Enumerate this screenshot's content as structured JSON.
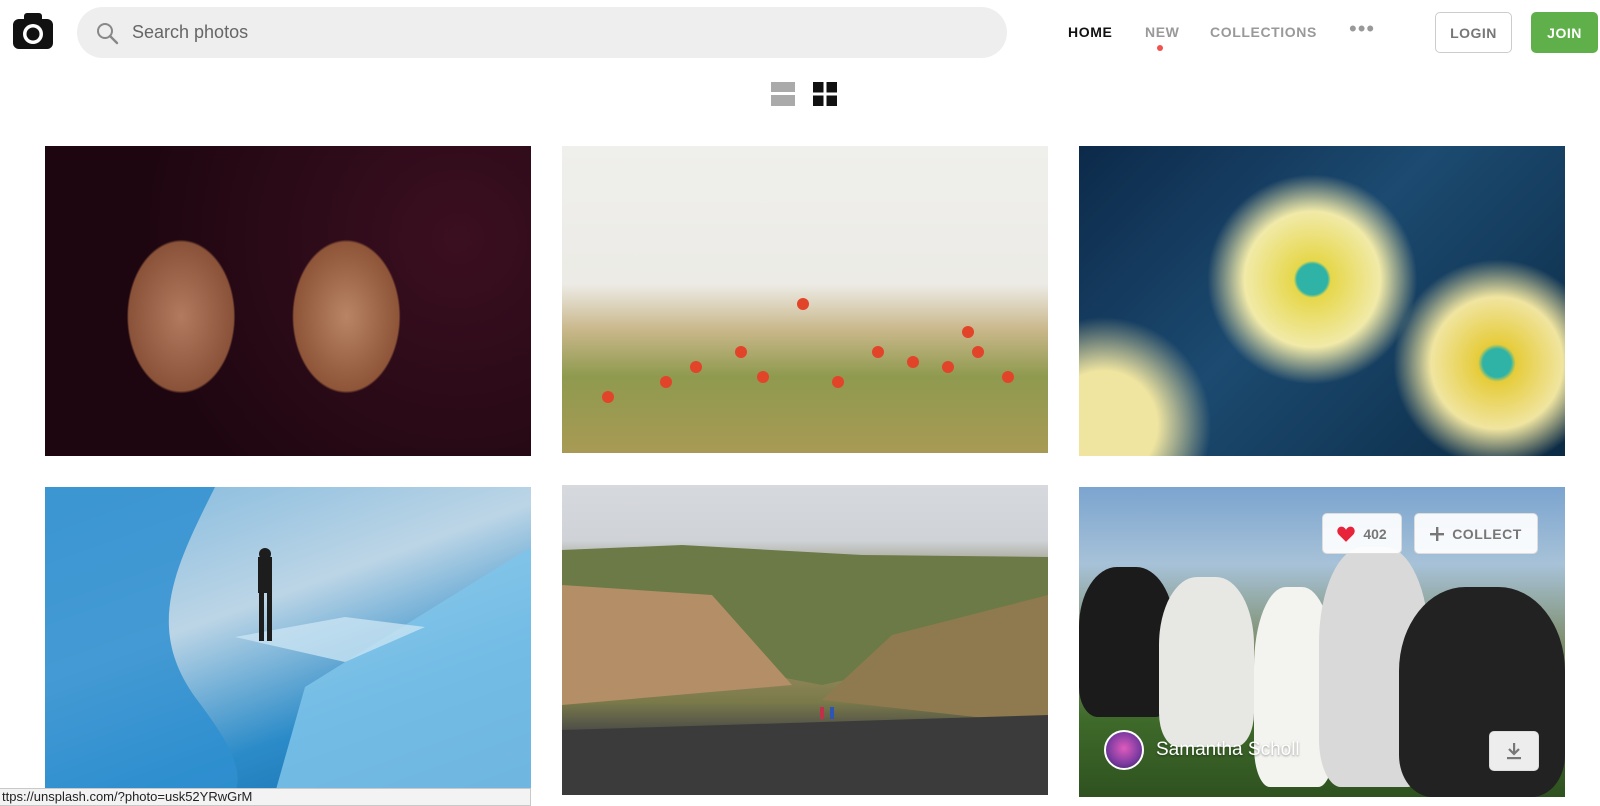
{
  "header": {
    "logo_icon": "camera-icon",
    "search": {
      "placeholder": "Search photos",
      "value": ""
    },
    "nav": {
      "home": "HOME",
      "new": "NEW",
      "collections": "COLLECTIONS",
      "more": "•••"
    },
    "login_label": "LOGIN",
    "join_label": "JOIN",
    "accent_color": "#5fb04a",
    "new_dot_color": "#f15151"
  },
  "view_toggle": {
    "list_icon": "list-view-icon",
    "grid_icon": "grid-view-icon",
    "active": "grid"
  },
  "photos": [
    {
      "subject": "henna hands"
    },
    {
      "subject": "poppy field"
    },
    {
      "subject": "yellow flowers"
    },
    {
      "subject": "glacier ice"
    },
    {
      "subject": "mountain valley hikers"
    },
    {
      "subject": "horses",
      "likes": "402",
      "collect_label": "COLLECT",
      "author": "Samantha Scholl"
    }
  ],
  "status_bar": {
    "url": "ttps://unsplash.com/?photo=usk52YRwGrM"
  }
}
